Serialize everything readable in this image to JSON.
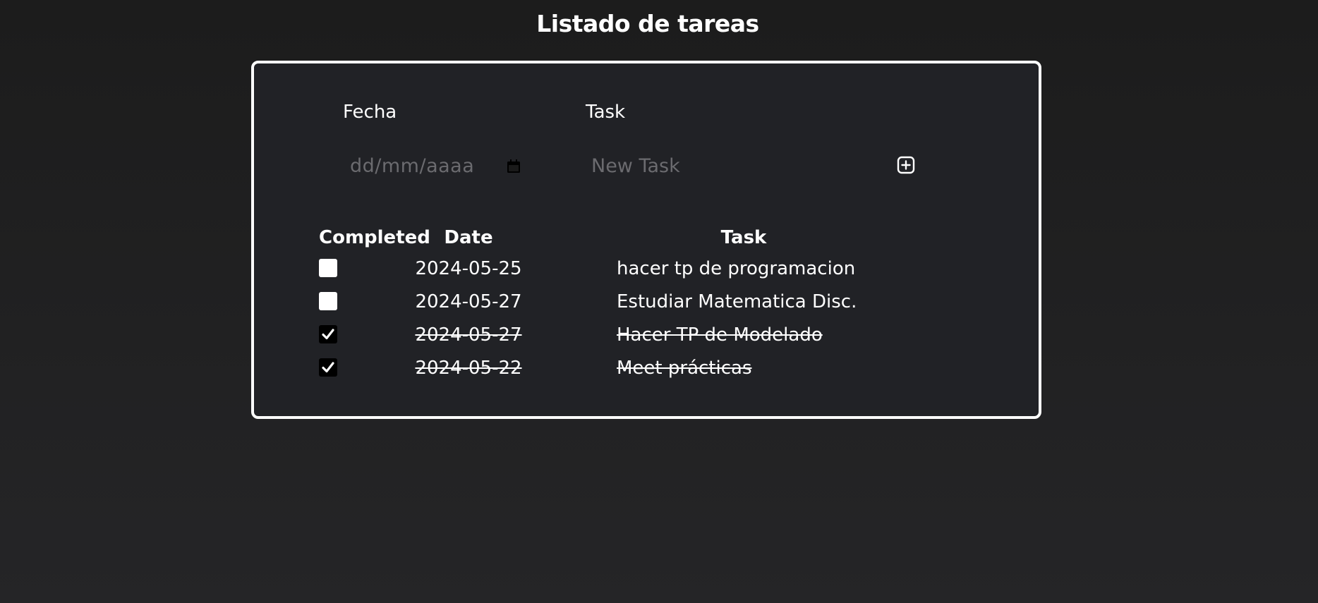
{
  "page": {
    "title": "Listado de tareas"
  },
  "form": {
    "date_label": "Fecha",
    "date_placeholder": "dd/mm/aaaa",
    "task_label": "Task",
    "task_placeholder": "New Task",
    "add_icon": "plus-square-icon",
    "calendar_icon": "calendar-icon"
  },
  "table": {
    "headers": {
      "completed": "Completed",
      "date": "Date",
      "task": "Task"
    },
    "rows": [
      {
        "completed": false,
        "date": "2024-05-25",
        "task": "hacer tp de programacion"
      },
      {
        "completed": false,
        "date": "2024-05-27",
        "task": "Estudiar Matematica Disc."
      },
      {
        "completed": true,
        "date": "2024-05-27",
        "task": "Hacer TP de Modelado"
      },
      {
        "completed": true,
        "date": "2024-05-22",
        "task": "Meet prácticas"
      }
    ]
  },
  "colors": {
    "background": "#1c1c1c",
    "card": "#212226",
    "border": "#ffffff",
    "text": "#ffffff",
    "placeholder": "#6b6b6f"
  }
}
